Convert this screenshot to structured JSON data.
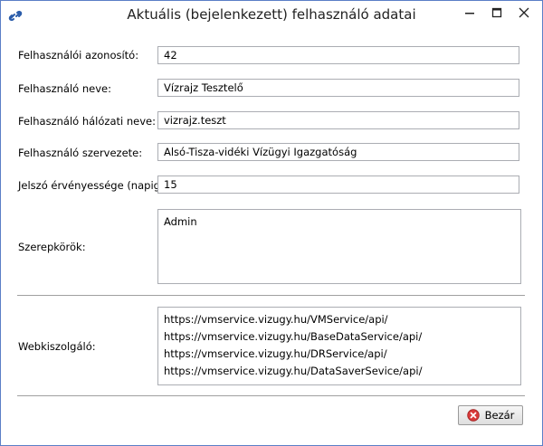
{
  "window": {
    "title": "Aktuális (bejelenkezett) felhasználó adatai",
    "controls": [
      "minimize-icon",
      "maximize-icon",
      "close-icon"
    ],
    "accent_color": "#5b7fc7"
  },
  "fields": [
    {
      "label": "Felhasználói azonosító:",
      "value": "42"
    },
    {
      "label": "Felhasználó neve:",
      "value": "Vízrajz Tesztelő"
    },
    {
      "label": "Felhasználó hálózati neve:",
      "value": "vizrajz.teszt"
    },
    {
      "label": "Felhasználó szervezete:",
      "value": "Alsó-Tisza-vidéki Vízügyi Igazgatóság"
    },
    {
      "label": "Jelszó érvényessége (napig)",
      "value": "15"
    }
  ],
  "roles": {
    "label": "Szerepkörök:",
    "items": [
      "Admin"
    ]
  },
  "webservices": {
    "label": "Webkiszolgáló:",
    "items": [
      "https://vmservice.vizugy.hu/VMService/api/",
      "https://vmservice.vizugy.hu/BaseDataService/api/",
      "https://vmservice.vizugy.hu/DRService/api/",
      "https://vmservice.vizugy.hu/DataSaverSevice/api/"
    ]
  },
  "close_button": {
    "label": "Bezár",
    "icon": "close-circle-icon",
    "icon_color": "#d93a3a"
  }
}
